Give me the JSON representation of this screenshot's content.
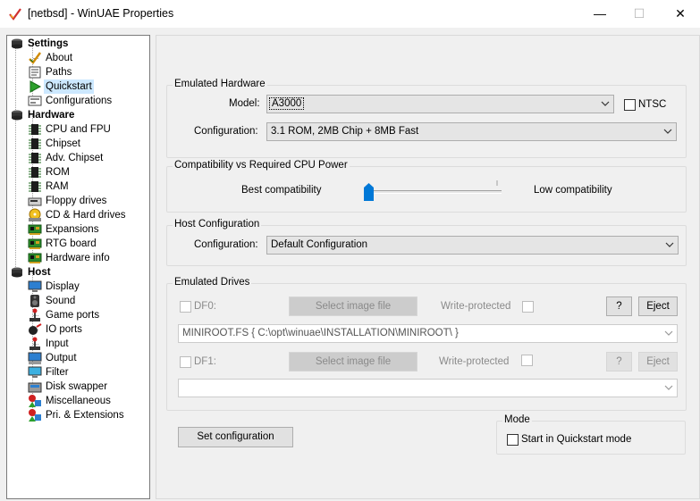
{
  "window": {
    "title": "[netbsd] - WinUAE Properties",
    "minimize_glyph": "—",
    "maximize_glyph": "☐",
    "close_glyph": "✕"
  },
  "tree": {
    "items": [
      {
        "label": "Settings",
        "icon": "settings-icon",
        "bold": true
      },
      {
        "label": "About",
        "icon": "check-icon"
      },
      {
        "label": "Paths",
        "icon": "paths-icon"
      },
      {
        "label": "Quickstart",
        "icon": "play-icon",
        "selected": true
      },
      {
        "label": "Configurations",
        "icon": "configurations-icon"
      },
      {
        "label": "Hardware",
        "icon": "hardware-icon",
        "bold": true
      },
      {
        "label": "CPU and FPU",
        "icon": "chip-icon"
      },
      {
        "label": "Chipset",
        "icon": "chip-icon"
      },
      {
        "label": "Adv. Chipset",
        "icon": "chip-icon"
      },
      {
        "label": "ROM",
        "icon": "chip-icon"
      },
      {
        "label": "RAM",
        "icon": "chip-icon"
      },
      {
        "label": "Floppy drives",
        "icon": "floppy-icon"
      },
      {
        "label": "CD & Hard drives",
        "icon": "hard-drive-icon"
      },
      {
        "label": "Expansions",
        "icon": "expansion-card-icon"
      },
      {
        "label": "RTG board",
        "icon": "expansion-card-icon"
      },
      {
        "label": "Hardware info",
        "icon": "expansion-card-icon"
      },
      {
        "label": "Host",
        "icon": "host-icon",
        "bold": true
      },
      {
        "label": "Display",
        "icon": "display-icon"
      },
      {
        "label": "Sound",
        "icon": "sound-icon"
      },
      {
        "label": "Game ports",
        "icon": "joystick-icon"
      },
      {
        "label": "IO ports",
        "icon": "io-ports-icon"
      },
      {
        "label": "Input",
        "icon": "joystick-icon"
      },
      {
        "label": "Output",
        "icon": "output-icon"
      },
      {
        "label": "Filter",
        "icon": "filter-icon"
      },
      {
        "label": "Disk swapper",
        "icon": "disk-swapper-icon"
      },
      {
        "label": "Miscellaneous",
        "icon": "misc-icon"
      },
      {
        "label": "Pri. & Extensions",
        "icon": "misc-icon"
      }
    ]
  },
  "emulated_hardware": {
    "title": "Emulated Hardware",
    "model_label": "Model:",
    "model_value": "A3000",
    "ntsc_label": "NTSC",
    "ntsc_checked": false,
    "configuration_label": "Configuration:",
    "configuration_value": "3.1 ROM, 2MB Chip + 8MB Fast"
  },
  "compatibility": {
    "title": "Compatibility vs Required CPU Power",
    "left_label": "Best compatibility",
    "right_label": "Low compatibility",
    "slider_level": 0
  },
  "host_configuration": {
    "title": "Host Configuration",
    "configuration_label": "Configuration:",
    "configuration_value": "Default Configuration"
  },
  "emulated_drives": {
    "title": "Emulated Drives",
    "df0": {
      "label": "DF0:",
      "select_label": "Select image file",
      "write_protected_label": "Write-protected",
      "help_label": "?",
      "eject_label": "Eject",
      "path": "MINIROOT.FS { C:\\opt\\winuae\\INSTALLATION\\MINIROOT\\ }"
    },
    "df1": {
      "label": "DF1:",
      "select_label": "Select image file",
      "write_protected_label": "Write-protected",
      "help_label": "?",
      "eject_label": "Eject",
      "path": ""
    }
  },
  "set_configuration_label": "Set configuration",
  "mode": {
    "title": "Mode",
    "start_quickstart_label": "Start in Quickstart mode",
    "start_quickstart_checked": false
  }
}
